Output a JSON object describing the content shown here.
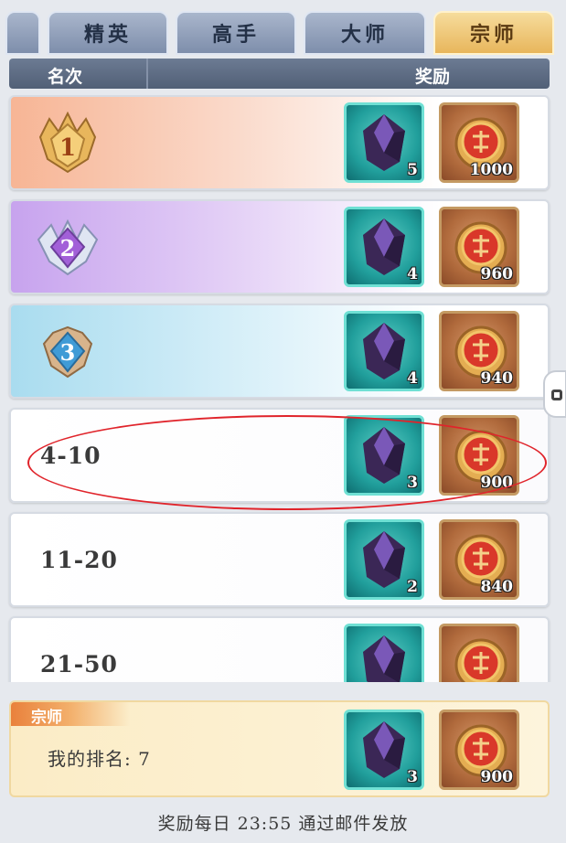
{
  "tabs": [
    {
      "label": "精英",
      "active": false
    },
    {
      "label": "高手",
      "active": false
    },
    {
      "label": "大师",
      "active": false
    },
    {
      "label": "宗师",
      "active": true
    }
  ],
  "header": {
    "rank_col": "名次",
    "reward_col": "奖励"
  },
  "rows": [
    {
      "rank": "1",
      "crystal_qty": "5",
      "coin_qty": "1000"
    },
    {
      "rank": "2",
      "crystal_qty": "4",
      "coin_qty": "960"
    },
    {
      "rank": "3",
      "crystal_qty": "4",
      "coin_qty": "940"
    },
    {
      "rank": "4-10",
      "crystal_qty": "3",
      "coin_qty": "900"
    },
    {
      "rank": "11-20",
      "crystal_qty": "2",
      "coin_qty": "840"
    },
    {
      "rank": "21-50",
      "crystal_qty": "",
      "coin_qty": ""
    }
  ],
  "my": {
    "tier": "宗师",
    "rank_text": "我的排名: 7",
    "crystal_qty": "3",
    "coin_qty": "900"
  },
  "footer": "奖励每日 23:55 通过邮件发放",
  "colors": {
    "accent_gold": "#e8b65c",
    "highlight_red": "#e0242b",
    "crystal_teal": "#219f9c",
    "coin_bronze": "#b06a3c"
  }
}
